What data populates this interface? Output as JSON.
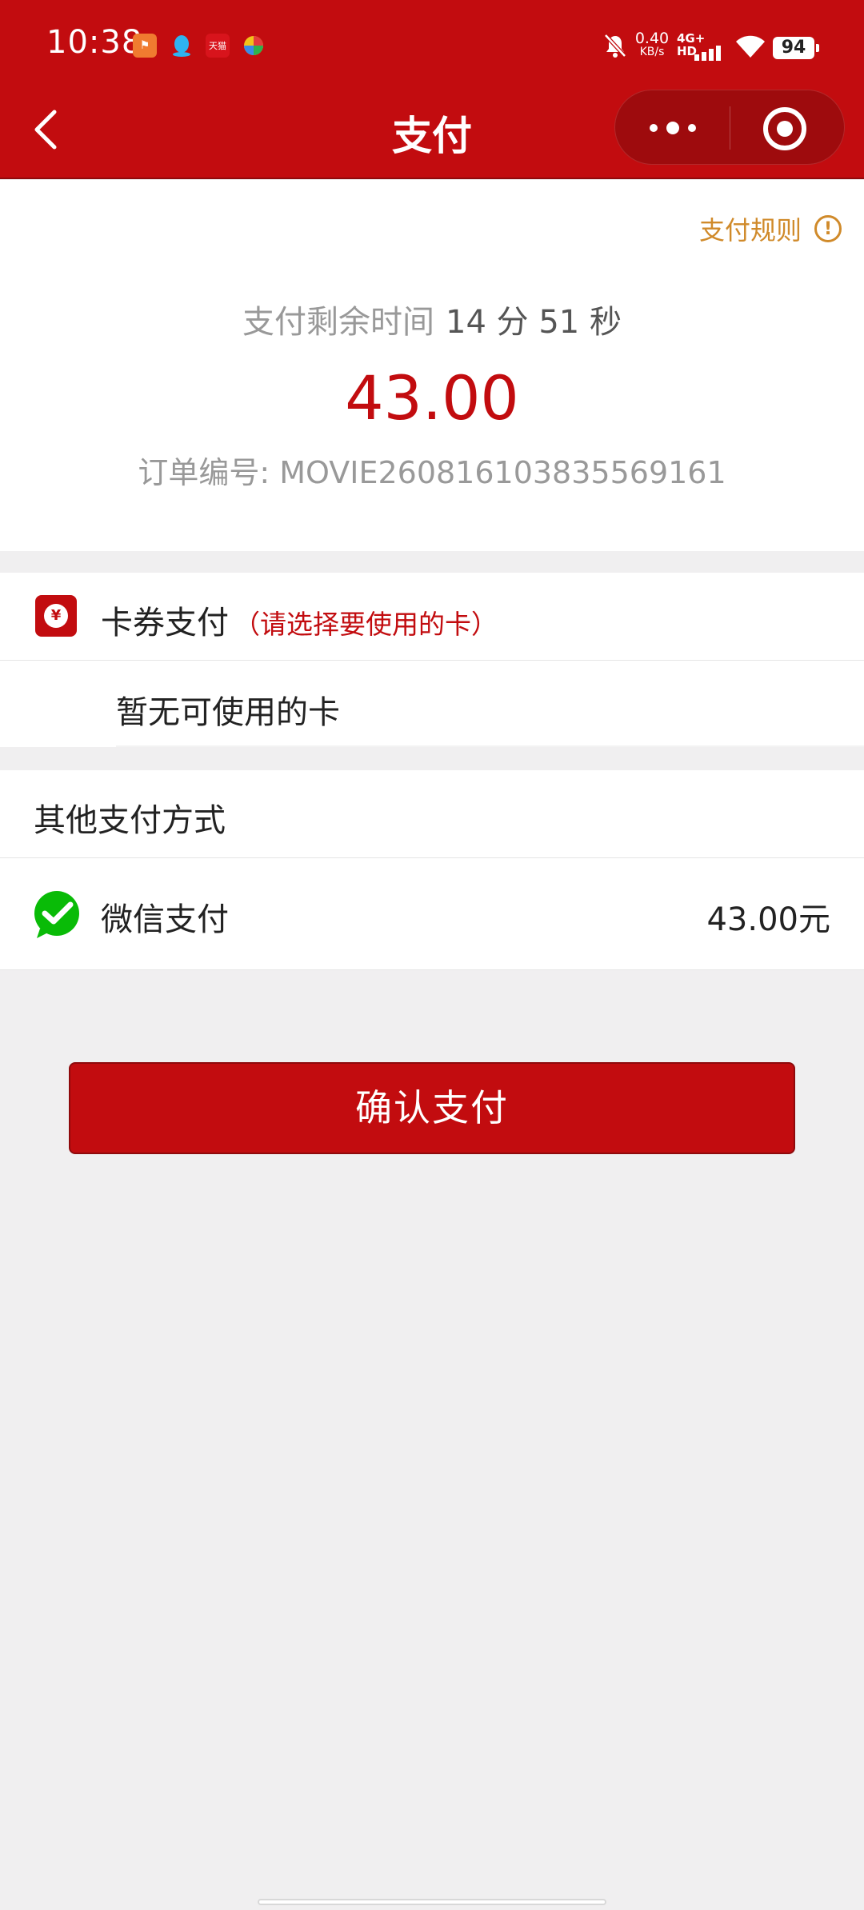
{
  "status_bar": {
    "time": "10:38",
    "net_speed": "0.40",
    "net_speed_unit": "KB/s",
    "network": "4G+ HD",
    "battery": "94"
  },
  "nav": {
    "title": "支付"
  },
  "payment_info": {
    "rules_label": "支付规则",
    "timer_label": "支付剩余时间",
    "timer_value": "14 分 51 秒",
    "amount": "43.00",
    "order_number": "订单编号: MOVIE260816103835569161"
  },
  "coupon": {
    "title": "卡券支付",
    "hint": "（请选择要使用的卡）",
    "empty_text": "暂无可使用的卡"
  },
  "other_payment": {
    "title": "其他支付方式",
    "wechat_label": "微信支付",
    "wechat_amount": "43.00元"
  },
  "confirm_button": "确认支付",
  "colors": {
    "brand_red": "#c20c0f",
    "rules_orange": "#d08a2a",
    "wechat_green": "#09bb07"
  }
}
